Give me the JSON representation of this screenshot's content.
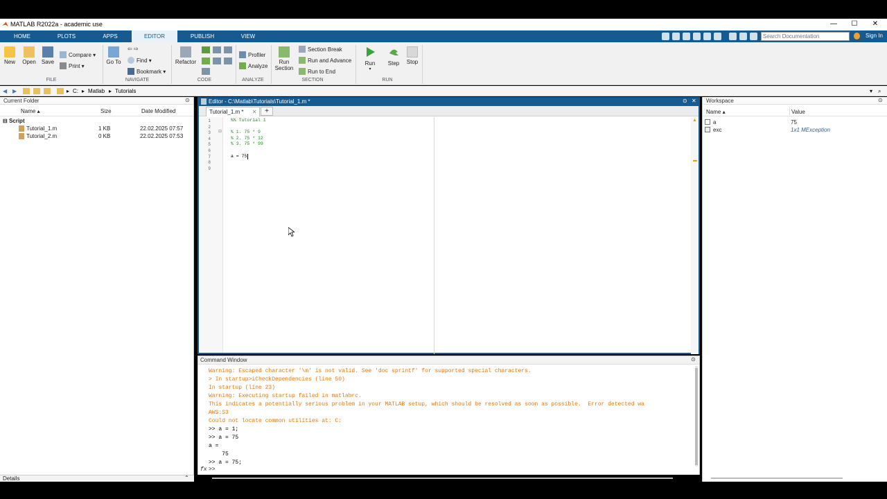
{
  "window": {
    "title": "MATLAB R2022a - academic use"
  },
  "ribbon_tabs": [
    {
      "label": "HOME"
    },
    {
      "label": "PLOTS"
    },
    {
      "label": "APPS"
    },
    {
      "label": "EDITOR"
    },
    {
      "label": "PUBLISH"
    },
    {
      "label": "VIEW"
    }
  ],
  "search": {
    "placeholder": "Search Documentation"
  },
  "signin_label": "Sign In",
  "ribbon": {
    "file": {
      "group_label": "FILE",
      "new": "New",
      "open": "Open",
      "save": "Save",
      "compare": "Compare",
      "print": "Print"
    },
    "navigate": {
      "group_label": "NAVIGATE",
      "goto": "Go To",
      "find": "Find",
      "bookmark": "Bookmark"
    },
    "code": {
      "group_label": "CODE",
      "refactor": "Refactor"
    },
    "analyze": {
      "group_label": "ANALYZE",
      "profiler": "Profiler",
      "analyze": "Analyze"
    },
    "section": {
      "group_label": "SECTION",
      "run_section_1": "Run",
      "run_section_2": "Section",
      "section_break": "Section Break",
      "run_and_advance": "Run and Advance",
      "run_to_end": "Run to End"
    },
    "run": {
      "group_label": "RUN",
      "run": "Run",
      "step": "Step",
      "stop": "Stop"
    }
  },
  "address": {
    "crumbs": [
      "C:",
      "Matlab",
      "Tutorials"
    ]
  },
  "current_folder": {
    "title": "Current Folder",
    "columns": {
      "name": "Name",
      "size": "Size",
      "date": "Date Modified"
    },
    "group": "Script",
    "files": [
      {
        "name": "Tutorial_1.m",
        "size": "1 KB",
        "date": "22.02.2025 07:57"
      },
      {
        "name": "Tutorial_2.m",
        "size": "0 KB",
        "date": "22.02.2025 07:53"
      }
    ],
    "details_label": "Details"
  },
  "editor": {
    "title": "Editor - C:\\Matlab\\Tutorials\\Tutorial_1.m *",
    "tab_label": "Tutorial_1.m *",
    "lines": [
      {
        "n": "1",
        "text": "%% Tutorial 1",
        "kind": "cmt"
      },
      {
        "n": "2",
        "text": "",
        "kind": "txt"
      },
      {
        "n": "3",
        "text": "% 1. 75 * 9",
        "kind": "cmt"
      },
      {
        "n": "4",
        "text": "% 2. 75 * 12",
        "kind": "cmt"
      },
      {
        "n": "5",
        "text": "% 3. 75 * 99",
        "kind": "cmt"
      },
      {
        "n": "6",
        "text": "",
        "kind": "txt"
      },
      {
        "n": "7",
        "text": "a = 75",
        "kind": "txt"
      },
      {
        "n": "8",
        "text": "",
        "kind": "txt"
      },
      {
        "n": "9",
        "text": "",
        "kind": "txt"
      }
    ]
  },
  "command_window": {
    "title": "Command Window",
    "lines": [
      {
        "text": "Warning: Escaped character '\\m' is not valid. See 'doc sprintf' for supported special characters.",
        "kind": "warn"
      },
      {
        "text": "> In startup>iCheckDependencies (line 50)",
        "kind": "warn"
      },
      {
        "text": "In startup (line 23)",
        "kind": "warn"
      },
      {
        "text": "Warning: Executing startup failed in matlabrc.",
        "kind": "warn"
      },
      {
        "text": "This indicates a potentially serious problem in your MATLAB setup, which should be resolved as soon as possible.  Error detected wa",
        "kind": "warn"
      },
      {
        "text": "AWS:S3",
        "kind": "warn"
      },
      {
        "text": "Could not locate common utilities at: C:",
        "kind": "warn"
      },
      {
        "text": ">> a = 1;",
        "kind": "out"
      },
      {
        "text": ">> a = 75",
        "kind": "out"
      },
      {
        "text": "a =",
        "kind": "out"
      },
      {
        "text": "    75",
        "kind": "out"
      },
      {
        "text": ">> a = 75;",
        "kind": "out"
      }
    ],
    "prompt": ">>",
    "fx": "fx"
  },
  "workspace": {
    "title": "Workspace",
    "columns": {
      "name": "Name",
      "value": "Value"
    },
    "vars": [
      {
        "name": "a",
        "value": "75"
      },
      {
        "name": "exc",
        "value": "1x1 MException"
      }
    ]
  },
  "colors": {
    "accent": "#175a8f",
    "warning": "#e8780c",
    "comment": "#228b22"
  }
}
